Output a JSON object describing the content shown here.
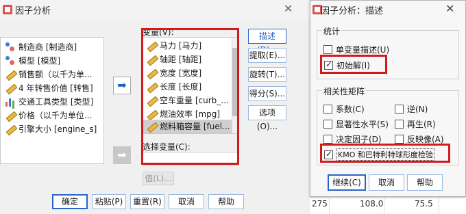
{
  "main_dialog": {
    "title": "因子分析",
    "close_glyph": "✕",
    "source_variables": [
      {
        "label": "制造商 [制造商]",
        "icon": "nominal"
      },
      {
        "label": "模型 [模型]",
        "icon": "nominal"
      },
      {
        "label": "销售额（以千为单...",
        "icon": "scale"
      },
      {
        "label": "4 年转售价值 [转售]",
        "icon": "scale"
      },
      {
        "label": "交通工具类型 [类型]",
        "icon": "ordinal"
      },
      {
        "label": "价格（以千为单位...",
        "icon": "scale"
      },
      {
        "label": "引擎大小 [engine_s]",
        "icon": "scale"
      }
    ],
    "variables_label": "变量(V):",
    "variables": [
      "马力 [马力]",
      "轴距 [轴距]",
      "宽度 [宽度]",
      "长度 [长度]",
      "空车重量 [curb_...",
      "燃油效率 [mpg]",
      "燃料箱容量 [fuel..."
    ],
    "selection_variable_label": "选择变量(C):",
    "value_button": "值(L)...",
    "side_buttons": [
      "描述(D)...",
      "提取(E)...",
      "旋转(T)...",
      "得分(S)...",
      "选项(O)..."
    ],
    "bottom_buttons": [
      "确定",
      "粘贴(P)",
      "重置(R)",
      "取消",
      "帮助"
    ]
  },
  "describe_dialog": {
    "title": "因子分析：描述",
    "close_glyph": "✕",
    "statistics_group": "统计",
    "univariate": {
      "label": "单变量描述(U)",
      "checked": false
    },
    "initial_solution": {
      "label": "初始解(I)",
      "checked": true
    },
    "correlation_group": "相关性矩阵",
    "coefficients": {
      "label": "系数(C)",
      "checked": false
    },
    "inverse": {
      "label": "逆(N)",
      "checked": false
    },
    "significance": {
      "label": "显著性水平(S)",
      "checked": false
    },
    "reproduced": {
      "label": "再生(R)",
      "checked": false
    },
    "determinant": {
      "label": "决定因子(D)",
      "checked": false
    },
    "anti_image": {
      "label": "反映像(A)",
      "checked": false
    },
    "kmo": {
      "label": "KMO 和巴特利特球形度检验",
      "checked": true
    },
    "buttons": [
      "继续(C)",
      "取消",
      "帮助"
    ]
  },
  "background_grid": [
    "275",
    "108.0",
    "75.5"
  ],
  "colors": {
    "highlight_red": "#d11a1a",
    "accent_blue": "#2a65c9"
  }
}
